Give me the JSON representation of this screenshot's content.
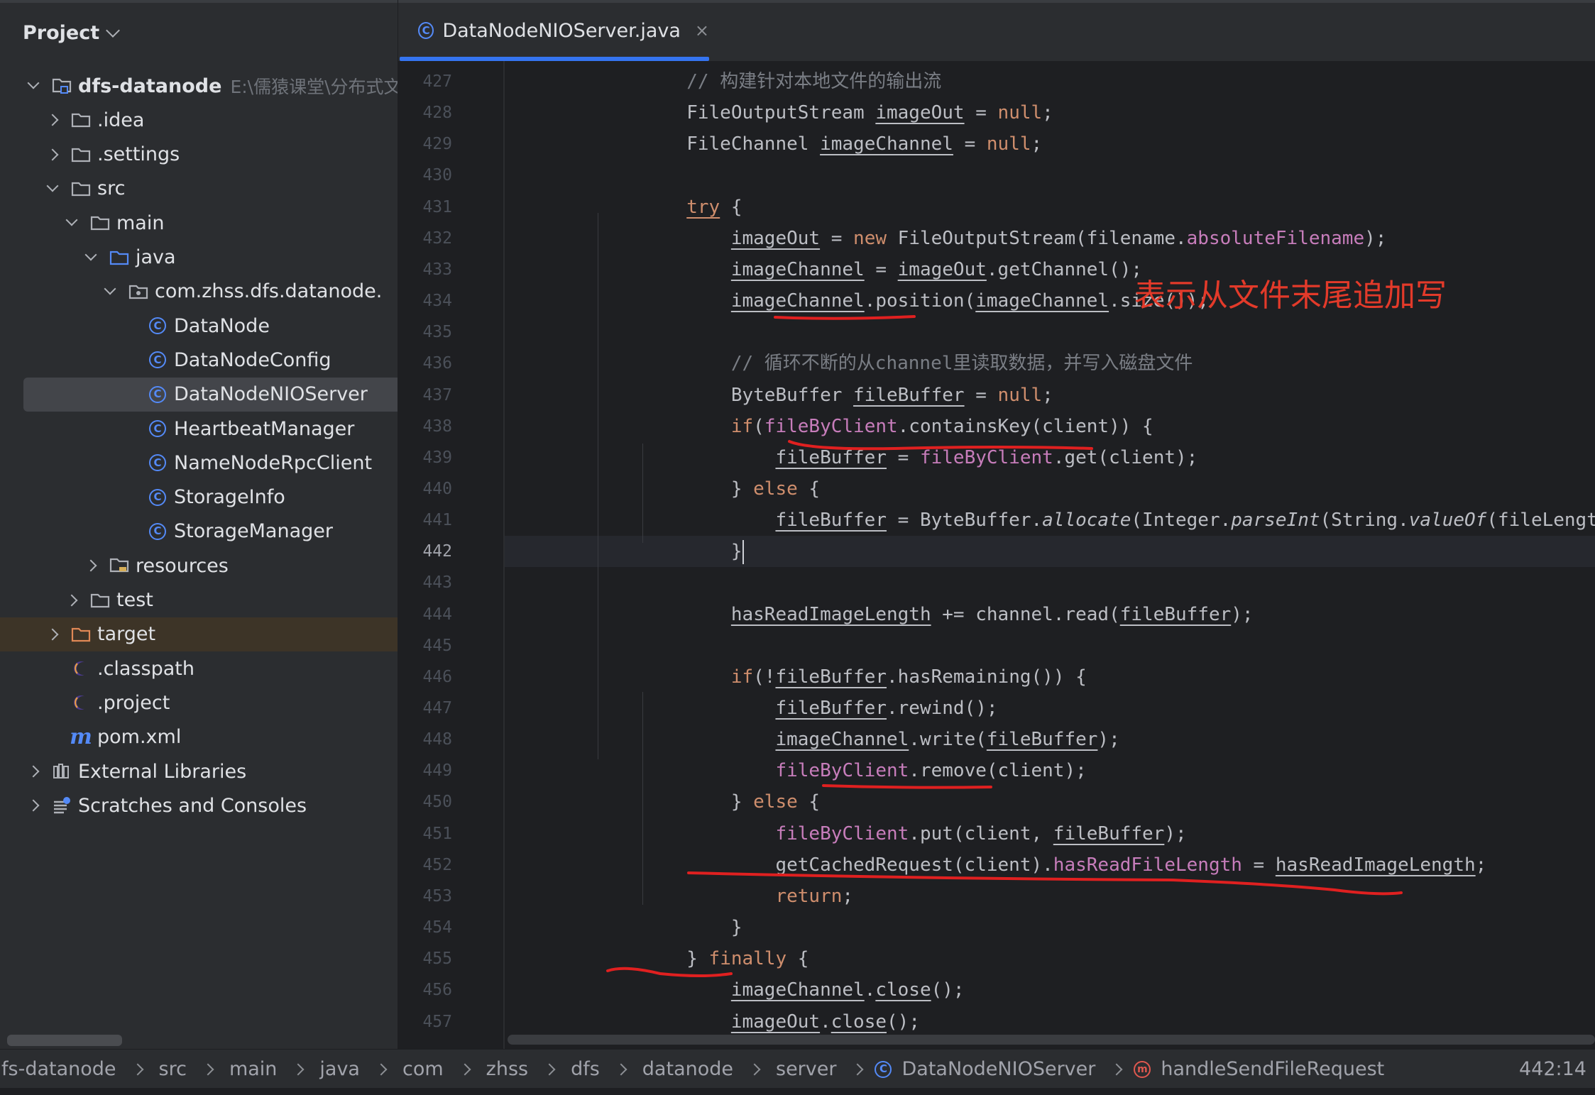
{
  "project_panel": {
    "title": "Project",
    "tree": [
      {
        "label": "dfs-datanode",
        "path": "E:\\儒猿课堂\\分布式文件",
        "arrow": "down",
        "icon": "module-folder-icon",
        "indent": 0
      },
      {
        "label": ".idea",
        "arrow": "right",
        "icon": "folder-icon",
        "indent": 1
      },
      {
        "label": ".settings",
        "arrow": "right",
        "icon": "folder-icon",
        "indent": 1
      },
      {
        "label": "src",
        "arrow": "down",
        "icon": "folder-icon",
        "indent": 1
      },
      {
        "label": "main",
        "arrow": "down",
        "icon": "folder-icon",
        "indent": 2
      },
      {
        "label": "java",
        "arrow": "down",
        "icon": "source-folder-icon",
        "indent": 3
      },
      {
        "label": "com.zhss.dfs.datanode.",
        "arrow": "down",
        "icon": "package-icon",
        "indent": 4
      },
      {
        "label": "DataNode",
        "arrow": "",
        "icon": "class-icon",
        "indent": 5
      },
      {
        "label": "DataNodeConfig",
        "arrow": "",
        "icon": "class-icon",
        "indent": 5
      },
      {
        "label": "DataNodeNIOServer",
        "arrow": "",
        "icon": "class-icon",
        "indent": 5,
        "selected": true
      },
      {
        "label": "HeartbeatManager",
        "arrow": "",
        "icon": "class-icon",
        "indent": 5
      },
      {
        "label": "NameNodeRpcClient",
        "arrow": "",
        "icon": "class-icon",
        "indent": 5
      },
      {
        "label": "StorageInfo",
        "arrow": "",
        "icon": "class-icon",
        "indent": 5
      },
      {
        "label": "StorageManager",
        "arrow": "",
        "icon": "class-icon",
        "indent": 5
      },
      {
        "label": "resources",
        "arrow": "right",
        "icon": "resources-folder-icon",
        "indent": 3
      },
      {
        "label": "test",
        "arrow": "right",
        "icon": "folder-icon",
        "indent": 2
      },
      {
        "label": "target",
        "arrow": "right",
        "icon": "excluded-folder-icon",
        "indent": 1,
        "highlight": true
      },
      {
        "label": ".classpath",
        "arrow": "",
        "icon": "eclipse-file-icon",
        "indent": 1
      },
      {
        "label": ".project",
        "arrow": "",
        "icon": "eclipse-file-icon",
        "indent": 1
      },
      {
        "label": "pom.xml",
        "arrow": "",
        "icon": "maven-icon",
        "indent": 1
      },
      {
        "label": "External Libraries",
        "arrow": "right",
        "icon": "libraries-icon",
        "indent": 0
      },
      {
        "label": "Scratches and Consoles",
        "arrow": "right",
        "icon": "scratches-icon",
        "indent": 0
      }
    ]
  },
  "editor": {
    "tab_title": "DataNodeNIOServer.java",
    "tab_close": "×",
    "current_line": "442",
    "annotation": "表示从文件末尾追加写",
    "lines": [
      {
        "num": "427",
        "segments": [
          {
            "t": "        ",
            "c": ""
          },
          {
            "t": "// 构建针对本地文件的输出流",
            "c": "cmt"
          }
        ]
      },
      {
        "num": "428",
        "segments": [
          {
            "t": "        FileOutputStream ",
            "c": ""
          },
          {
            "t": "imageOut",
            "c": "u"
          },
          {
            "t": " = ",
            "c": ""
          },
          {
            "t": "null",
            "c": "kw"
          },
          {
            "t": ";",
            "c": ""
          }
        ]
      },
      {
        "num": "429",
        "segments": [
          {
            "t": "        FileChannel ",
            "c": ""
          },
          {
            "t": "imageChannel",
            "c": "u"
          },
          {
            "t": " = ",
            "c": ""
          },
          {
            "t": "null",
            "c": "kw"
          },
          {
            "t": ";",
            "c": ""
          }
        ]
      },
      {
        "num": "430",
        "segments": []
      },
      {
        "num": "431",
        "segments": [
          {
            "t": "        ",
            "c": ""
          },
          {
            "t": "try",
            "c": "kw u"
          },
          {
            "t": " {",
            "c": ""
          }
        ]
      },
      {
        "num": "432",
        "segments": [
          {
            "t": "            ",
            "c": ""
          },
          {
            "t": "imageOut",
            "c": "u"
          },
          {
            "t": " = ",
            "c": ""
          },
          {
            "t": "new",
            "c": "kw"
          },
          {
            "t": " FileOutputStream(filename.",
            "c": ""
          },
          {
            "t": "absoluteFilename",
            "c": "fld"
          },
          {
            "t": ");",
            "c": ""
          }
        ]
      },
      {
        "num": "433",
        "segments": [
          {
            "t": "            ",
            "c": ""
          },
          {
            "t": "imageChannel",
            "c": "u"
          },
          {
            "t": " = ",
            "c": ""
          },
          {
            "t": "imageOut",
            "c": "u"
          },
          {
            "t": ".getChannel();",
            "c": ""
          }
        ]
      },
      {
        "num": "434",
        "segments": [
          {
            "t": "            ",
            "c": ""
          },
          {
            "t": "imageChannel",
            "c": "u"
          },
          {
            "t": ".position(",
            "c": ""
          },
          {
            "t": "imageChannel",
            "c": "u"
          },
          {
            "t": ".size());",
            "c": ""
          }
        ]
      },
      {
        "num": "435",
        "segments": []
      },
      {
        "num": "436",
        "segments": [
          {
            "t": "            ",
            "c": ""
          },
          {
            "t": "// 循环不断的从channel里读取数据，并写入磁盘文件",
            "c": "cmt"
          }
        ]
      },
      {
        "num": "437",
        "segments": [
          {
            "t": "            ByteBuffer ",
            "c": ""
          },
          {
            "t": "fileBuffer",
            "c": "u"
          },
          {
            "t": " = ",
            "c": ""
          },
          {
            "t": "null",
            "c": "kw"
          },
          {
            "t": ";",
            "c": ""
          }
        ]
      },
      {
        "num": "438",
        "segments": [
          {
            "t": "            ",
            "c": ""
          },
          {
            "t": "if",
            "c": "kw"
          },
          {
            "t": "(",
            "c": ""
          },
          {
            "t": "fileByClient",
            "c": "fld"
          },
          {
            "t": ".containsKey(client)) {",
            "c": ""
          }
        ]
      },
      {
        "num": "439",
        "segments": [
          {
            "t": "                ",
            "c": ""
          },
          {
            "t": "fileBuffer",
            "c": "u"
          },
          {
            "t": " = ",
            "c": ""
          },
          {
            "t": "fileByClient",
            "c": "fld"
          },
          {
            "t": ".get(client);",
            "c": ""
          }
        ]
      },
      {
        "num": "440",
        "segments": [
          {
            "t": "            } ",
            "c": ""
          },
          {
            "t": "else",
            "c": "kw"
          },
          {
            "t": " {",
            "c": ""
          }
        ]
      },
      {
        "num": "441",
        "segments": [
          {
            "t": "                ",
            "c": ""
          },
          {
            "t": "fileBuffer",
            "c": "u"
          },
          {
            "t": " = ByteBuffer.",
            "c": ""
          },
          {
            "t": "allocate",
            "c": "ital"
          },
          {
            "t": "(Integer.",
            "c": ""
          },
          {
            "t": "parseInt",
            "c": "ital"
          },
          {
            "t": "(String.",
            "c": ""
          },
          {
            "t": "valueOf",
            "c": "ital"
          },
          {
            "t": "(fileLength)));",
            "c": ""
          }
        ]
      },
      {
        "num": "442",
        "segments": [
          {
            "t": "            }",
            "c": ""
          }
        ]
      },
      {
        "num": "443",
        "segments": []
      },
      {
        "num": "444",
        "segments": [
          {
            "t": "            ",
            "c": ""
          },
          {
            "t": "hasReadImageLength",
            "c": "u"
          },
          {
            "t": " += channel.read(",
            "c": ""
          },
          {
            "t": "fileBuffer",
            "c": "u"
          },
          {
            "t": ");",
            "c": ""
          }
        ]
      },
      {
        "num": "445",
        "segments": []
      },
      {
        "num": "446",
        "segments": [
          {
            "t": "            ",
            "c": ""
          },
          {
            "t": "if",
            "c": "kw"
          },
          {
            "t": "(!",
            "c": ""
          },
          {
            "t": "fileBuffer",
            "c": "u"
          },
          {
            "t": ".hasRemaining()) {",
            "c": ""
          }
        ]
      },
      {
        "num": "447",
        "segments": [
          {
            "t": "                ",
            "c": ""
          },
          {
            "t": "fileBuffer",
            "c": "u"
          },
          {
            "t": ".rewind();",
            "c": ""
          }
        ]
      },
      {
        "num": "448",
        "segments": [
          {
            "t": "                ",
            "c": ""
          },
          {
            "t": "imageChannel",
            "c": "u"
          },
          {
            "t": ".write(",
            "c": ""
          },
          {
            "t": "fileBuffer",
            "c": "u"
          },
          {
            "t": ");",
            "c": ""
          }
        ]
      },
      {
        "num": "449",
        "segments": [
          {
            "t": "                ",
            "c": ""
          },
          {
            "t": "fileByClient",
            "c": "fld"
          },
          {
            "t": ".remove(client);",
            "c": ""
          }
        ]
      },
      {
        "num": "450",
        "segments": [
          {
            "t": "            } ",
            "c": ""
          },
          {
            "t": "else",
            "c": "kw"
          },
          {
            "t": " {",
            "c": ""
          }
        ]
      },
      {
        "num": "451",
        "segments": [
          {
            "t": "                ",
            "c": ""
          },
          {
            "t": "fileByClient",
            "c": "fld"
          },
          {
            "t": ".put(client, ",
            "c": ""
          },
          {
            "t": "fileBuffer",
            "c": "u"
          },
          {
            "t": ");",
            "c": ""
          }
        ]
      },
      {
        "num": "452",
        "segments": [
          {
            "t": "                getCachedRequest(client).",
            "c": ""
          },
          {
            "t": "hasReadFileLength",
            "c": "fld"
          },
          {
            "t": " = ",
            "c": ""
          },
          {
            "t": "hasReadImageLength",
            "c": "u"
          },
          {
            "t": ";",
            "c": ""
          }
        ]
      },
      {
        "num": "453",
        "segments": [
          {
            "t": "                ",
            "c": ""
          },
          {
            "t": "return",
            "c": "kw"
          },
          {
            "t": ";",
            "c": ""
          }
        ]
      },
      {
        "num": "454",
        "segments": [
          {
            "t": "            }",
            "c": ""
          }
        ]
      },
      {
        "num": "455",
        "segments": [
          {
            "t": "        } ",
            "c": ""
          },
          {
            "t": "finally",
            "c": "kw"
          },
          {
            "t": " {",
            "c": ""
          }
        ]
      },
      {
        "num": "456",
        "segments": [
          {
            "t": "            ",
            "c": ""
          },
          {
            "t": "imageChannel",
            "c": "u"
          },
          {
            "t": ".",
            "c": ""
          },
          {
            "t": "close",
            "c": "u"
          },
          {
            "t": "();",
            "c": ""
          }
        ]
      },
      {
        "num": "457",
        "segments": [
          {
            "t": "            ",
            "c": ""
          },
          {
            "t": "imageOut",
            "c": "u"
          },
          {
            "t": ".",
            "c": ""
          },
          {
            "t": "close",
            "c": "u"
          },
          {
            "t": "();",
            "c": ""
          }
        ]
      }
    ]
  },
  "status_bar": {
    "breadcrumbs": [
      "fs-datanode",
      "src",
      "main",
      "java",
      "com",
      "zhss",
      "dfs",
      "datanode",
      "server",
      "DataNodeNIOServer",
      "handleSendFileRequest"
    ],
    "caret_position": "442:14"
  },
  "colors": {
    "accent": "#3574f0",
    "annotation_red": "#e33a2a",
    "keyword": "#cf8e6d",
    "field": "#c77dbb"
  }
}
